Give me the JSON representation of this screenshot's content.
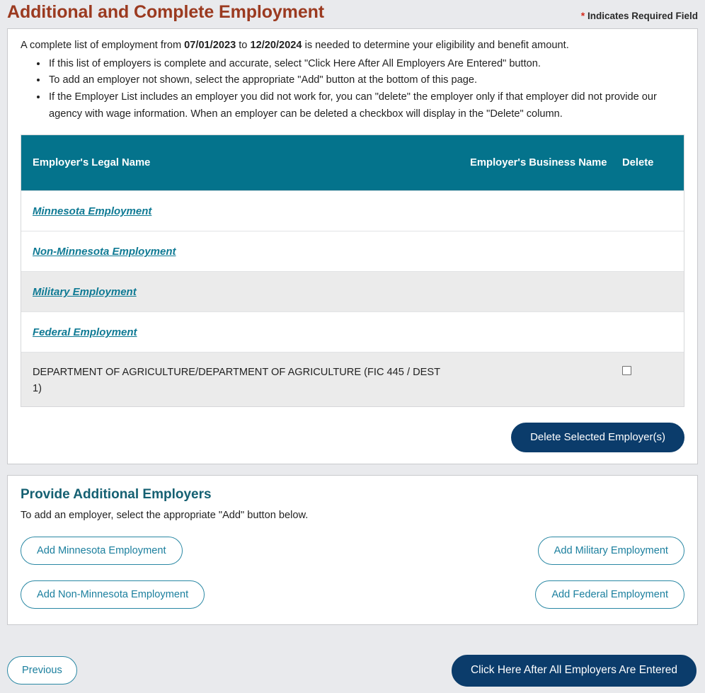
{
  "header": {
    "title": "Additional and Complete Employment",
    "required_star": "*",
    "required_note": "Indicates Required Field",
    "title_color": "#9b3a20",
    "star_color": "#d52b1e"
  },
  "intro": {
    "lead_before": "A complete list of employment from ",
    "date_from": "07/01/2023",
    "lead_middle": " to ",
    "date_to": "12/20/2024",
    "lead_after": " is needed to determine your eligibility and benefit amount.",
    "bullets": [
      "If this list of employers is complete and accurate, select \"Click Here After All Employers Are Entered\" button.",
      "To add an employer not shown, select the appropriate \"Add\" button at the bottom of this page.",
      "If the Employer List includes an employer you did not work for, you can \"delete\" the employer only if that employer did not provide our agency with wage information. When an employer can be deleted a checkbox will display in the \"Delete\" column."
    ]
  },
  "table": {
    "header_bg": "#04738c",
    "columns": {
      "legal_name": "Employer's Legal Name",
      "business_name": "Employer's Business Name",
      "delete": "Delete"
    },
    "rows": [
      {
        "legal_name": "Minnesota Employment",
        "business_name": "",
        "is_link": true,
        "has_checkbox": false,
        "striped": false
      },
      {
        "legal_name": "Non-Minnesota Employment",
        "business_name": "",
        "is_link": true,
        "has_checkbox": false,
        "striped": false
      },
      {
        "legal_name": "Military Employment",
        "business_name": "",
        "is_link": true,
        "has_checkbox": false,
        "striped": true
      },
      {
        "legal_name": "Federal Employment",
        "business_name": "",
        "is_link": true,
        "has_checkbox": false,
        "striped": false
      },
      {
        "legal_name": "DEPARTMENT OF AGRICULTURE/DEPARTMENT OF AGRICULTURE (FIC 445 / DEST 1)",
        "business_name": "",
        "is_link": false,
        "has_checkbox": true,
        "striped": true
      }
    ],
    "delete_button": "Delete Selected Employer(s)"
  },
  "additional": {
    "title": "Provide Additional Employers",
    "subtitle": "To add an employer, select the appropriate \"Add\" button below.",
    "buttons": {
      "add_minnesota": "Add Minnesota Employment",
      "add_military": "Add Military Employment",
      "add_non_minnesota": "Add Non-Minnesota Employment",
      "add_federal": "Add Federal Employment"
    }
  },
  "footer": {
    "previous": "Previous",
    "continue": "Click Here After All Employers Are Entered"
  },
  "colors": {
    "teal": "#04738c",
    "link_teal": "#0f7a94",
    "navy": "#0b3c6b",
    "page_bg": "#e9eaed"
  }
}
